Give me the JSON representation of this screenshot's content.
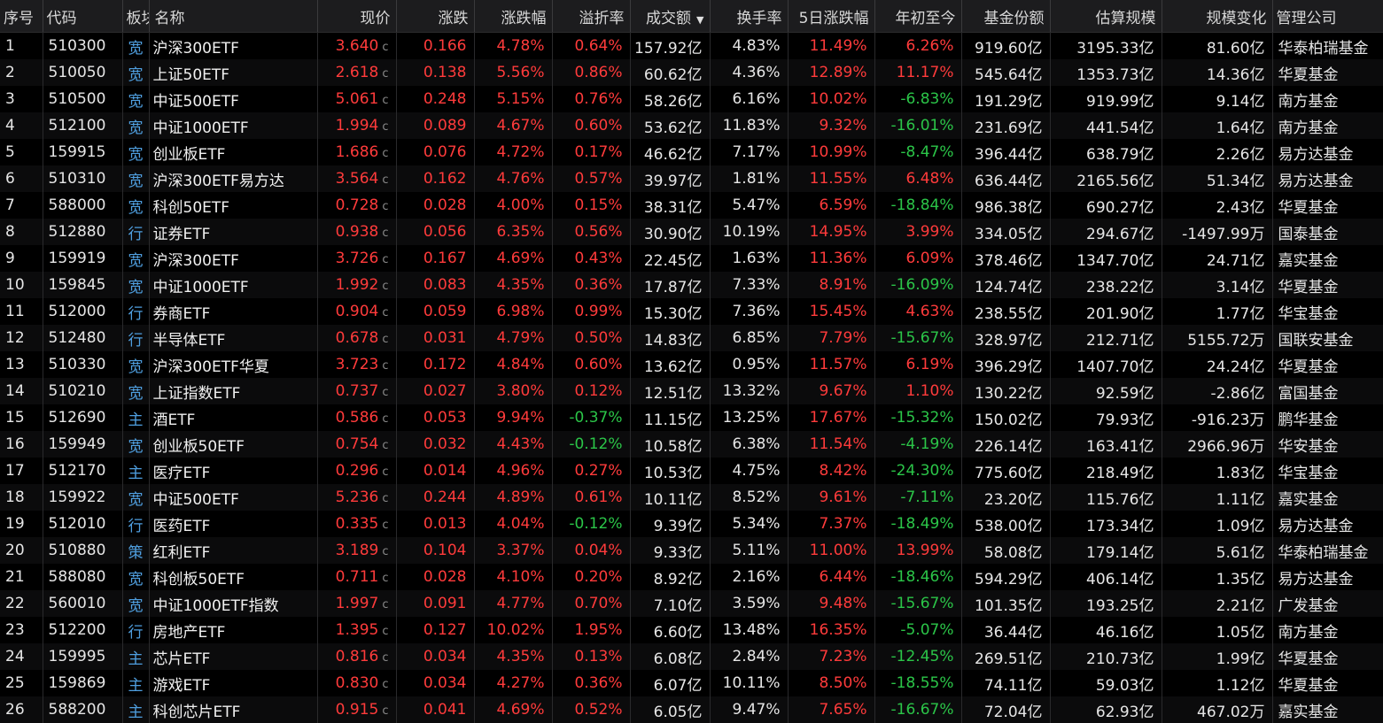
{
  "colors": {
    "up": "#ff3b3b",
    "down": "#2bc548",
    "sector": "#4f9fe0",
    "header_bg": "#1c1c1e"
  },
  "header": {
    "idx": "序号",
    "code": "代码",
    "sector": "板块",
    "name": "名称",
    "price": "现价",
    "change": "涨跌",
    "pct": "涨跌幅",
    "premium": "溢折率",
    "turnover_amt": "成交额",
    "turnover_rate": "换手率",
    "pct5d": "5日涨跌幅",
    "ytd": "年初至今",
    "shares": "基金份额",
    "scale": "估算规模",
    "scale_change": "规模变化",
    "manager": "管理公司"
  },
  "sort": {
    "column": "turnover_amt",
    "direction": "desc",
    "icon": "triangle-down"
  },
  "rows": [
    {
      "idx": "1",
      "code": "510300",
      "sector": "宽",
      "name": "沪深300ETF",
      "price": "3.640",
      "flag": "c",
      "change": "0.166",
      "pct": "4.78%",
      "premium": "0.64%",
      "premium_dir": "up",
      "turnover_amt": "157.92亿",
      "turnover_rate": "4.83%",
      "pct5d": "11.49%",
      "ytd": "6.26%",
      "ytd_dir": "up",
      "shares": "919.60亿",
      "scale": "3195.33亿",
      "scale_change": "81.60亿",
      "manager": "华泰柏瑞基金"
    },
    {
      "idx": "2",
      "code": "510050",
      "sector": "宽",
      "name": "上证50ETF",
      "price": "2.618",
      "flag": "c",
      "change": "0.138",
      "pct": "5.56%",
      "premium": "0.86%",
      "premium_dir": "up",
      "turnover_amt": "60.62亿",
      "turnover_rate": "4.36%",
      "pct5d": "12.89%",
      "ytd": "11.17%",
      "ytd_dir": "up",
      "shares": "545.64亿",
      "scale": "1353.73亿",
      "scale_change": "14.36亿",
      "manager": "华夏基金"
    },
    {
      "idx": "3",
      "code": "510500",
      "sector": "宽",
      "name": "中证500ETF",
      "price": "5.061",
      "flag": "c",
      "change": "0.248",
      "pct": "5.15%",
      "premium": "0.76%",
      "premium_dir": "up",
      "turnover_amt": "58.26亿",
      "turnover_rate": "6.16%",
      "pct5d": "10.02%",
      "ytd": "-6.83%",
      "ytd_dir": "down",
      "shares": "191.29亿",
      "scale": "919.99亿",
      "scale_change": "9.14亿",
      "manager": "南方基金"
    },
    {
      "idx": "4",
      "code": "512100",
      "sector": "宽",
      "name": "中证1000ETF",
      "price": "1.994",
      "flag": "c",
      "change": "0.089",
      "pct": "4.67%",
      "premium": "0.60%",
      "premium_dir": "up",
      "turnover_amt": "53.62亿",
      "turnover_rate": "11.83%",
      "pct5d": "9.32%",
      "ytd": "-16.01%",
      "ytd_dir": "down",
      "shares": "231.69亿",
      "scale": "441.54亿",
      "scale_change": "1.64亿",
      "manager": "南方基金"
    },
    {
      "idx": "5",
      "code": "159915",
      "sector": "宽",
      "name": "创业板ETF",
      "price": "1.686",
      "flag": "c",
      "change": "0.076",
      "pct": "4.72%",
      "premium": "0.17%",
      "premium_dir": "up",
      "turnover_amt": "46.62亿",
      "turnover_rate": "7.17%",
      "pct5d": "10.99%",
      "ytd": "-8.47%",
      "ytd_dir": "down",
      "shares": "396.44亿",
      "scale": "638.79亿",
      "scale_change": "2.26亿",
      "manager": "易方达基金"
    },
    {
      "idx": "6",
      "code": "510310",
      "sector": "宽",
      "name": "沪深300ETF易方达",
      "price": "3.564",
      "flag": "c",
      "change": "0.162",
      "pct": "4.76%",
      "premium": "0.57%",
      "premium_dir": "up",
      "turnover_amt": "39.97亿",
      "turnover_rate": "1.81%",
      "pct5d": "11.55%",
      "ytd": "6.48%",
      "ytd_dir": "up",
      "shares": "636.44亿",
      "scale": "2165.56亿",
      "scale_change": "51.34亿",
      "manager": "易方达基金"
    },
    {
      "idx": "7",
      "code": "588000",
      "sector": "宽",
      "name": "科创50ETF",
      "price": "0.728",
      "flag": "c",
      "change": "0.028",
      "pct": "4.00%",
      "premium": "0.15%",
      "premium_dir": "up",
      "turnover_amt": "38.31亿",
      "turnover_rate": "5.47%",
      "pct5d": "6.59%",
      "ytd": "-18.84%",
      "ytd_dir": "down",
      "shares": "986.38亿",
      "scale": "690.27亿",
      "scale_change": "2.43亿",
      "manager": "华夏基金"
    },
    {
      "idx": "8",
      "code": "512880",
      "sector": "行",
      "name": "证券ETF",
      "price": "0.938",
      "flag": "c",
      "change": "0.056",
      "pct": "6.35%",
      "premium": "0.56%",
      "premium_dir": "up",
      "turnover_amt": "30.90亿",
      "turnover_rate": "10.19%",
      "pct5d": "14.95%",
      "ytd": "3.99%",
      "ytd_dir": "up",
      "shares": "334.05亿",
      "scale": "294.67亿",
      "scale_change": "-1497.99万",
      "manager": "国泰基金"
    },
    {
      "idx": "9",
      "code": "159919",
      "sector": "宽",
      "name": "沪深300ETF",
      "price": "3.726",
      "flag": "c",
      "change": "0.167",
      "pct": "4.69%",
      "premium": "0.43%",
      "premium_dir": "up",
      "turnover_amt": "22.45亿",
      "turnover_rate": "1.63%",
      "pct5d": "11.36%",
      "ytd": "6.09%",
      "ytd_dir": "up",
      "shares": "378.46亿",
      "scale": "1347.70亿",
      "scale_change": "24.71亿",
      "manager": "嘉实基金"
    },
    {
      "idx": "10",
      "code": "159845",
      "sector": "宽",
      "name": "中证1000ETF",
      "price": "1.992",
      "flag": "c",
      "change": "0.083",
      "pct": "4.35%",
      "premium": "0.36%",
      "premium_dir": "up",
      "turnover_amt": "17.87亿",
      "turnover_rate": "7.33%",
      "pct5d": "8.91%",
      "ytd": "-16.09%",
      "ytd_dir": "down",
      "shares": "124.74亿",
      "scale": "238.22亿",
      "scale_change": "3.14亿",
      "manager": "华夏基金"
    },
    {
      "idx": "11",
      "code": "512000",
      "sector": "行",
      "name": "券商ETF",
      "price": "0.904",
      "flag": "c",
      "change": "0.059",
      "pct": "6.98%",
      "premium": "0.99%",
      "premium_dir": "up",
      "turnover_amt": "15.30亿",
      "turnover_rate": "7.36%",
      "pct5d": "15.45%",
      "ytd": "4.63%",
      "ytd_dir": "up",
      "shares": "238.55亿",
      "scale": "201.90亿",
      "scale_change": "1.77亿",
      "manager": "华宝基金"
    },
    {
      "idx": "12",
      "code": "512480",
      "sector": "行",
      "name": "半导体ETF",
      "price": "0.678",
      "flag": "c",
      "change": "0.031",
      "pct": "4.79%",
      "premium": "0.50%",
      "premium_dir": "up",
      "turnover_amt": "14.83亿",
      "turnover_rate": "6.85%",
      "pct5d": "7.79%",
      "ytd": "-15.67%",
      "ytd_dir": "down",
      "shares": "328.97亿",
      "scale": "212.71亿",
      "scale_change": "5155.72万",
      "manager": "国联安基金"
    },
    {
      "idx": "13",
      "code": "510330",
      "sector": "宽",
      "name": "沪深300ETF华夏",
      "price": "3.723",
      "flag": "c",
      "change": "0.172",
      "pct": "4.84%",
      "premium": "0.60%",
      "premium_dir": "up",
      "turnover_amt": "13.62亿",
      "turnover_rate": "0.95%",
      "pct5d": "11.57%",
      "ytd": "6.19%",
      "ytd_dir": "up",
      "shares": "396.29亿",
      "scale": "1407.70亿",
      "scale_change": "24.24亿",
      "manager": "华夏基金"
    },
    {
      "idx": "14",
      "code": "510210",
      "sector": "宽",
      "name": "上证指数ETF",
      "price": "0.737",
      "flag": "c",
      "change": "0.027",
      "pct": "3.80%",
      "premium": "0.12%",
      "premium_dir": "up",
      "turnover_amt": "12.51亿",
      "turnover_rate": "13.32%",
      "pct5d": "9.67%",
      "ytd": "1.10%",
      "ytd_dir": "up",
      "shares": "130.22亿",
      "scale": "92.59亿",
      "scale_change": "-2.86亿",
      "manager": "富国基金"
    },
    {
      "idx": "15",
      "code": "512690",
      "sector": "主",
      "name": "酒ETF",
      "price": "0.586",
      "flag": "c",
      "change": "0.053",
      "pct": "9.94%",
      "premium": "-0.37%",
      "premium_dir": "down",
      "turnover_amt": "11.15亿",
      "turnover_rate": "13.25%",
      "pct5d": "17.67%",
      "ytd": "-15.32%",
      "ytd_dir": "down",
      "shares": "150.02亿",
      "scale": "79.93亿",
      "scale_change": "-916.23万",
      "manager": "鹏华基金"
    },
    {
      "idx": "16",
      "code": "159949",
      "sector": "宽",
      "name": "创业板50ETF",
      "price": "0.754",
      "flag": "c",
      "change": "0.032",
      "pct": "4.43%",
      "premium": "-0.12%",
      "premium_dir": "down",
      "turnover_amt": "10.58亿",
      "turnover_rate": "6.38%",
      "pct5d": "11.54%",
      "ytd": "-4.19%",
      "ytd_dir": "down",
      "shares": "226.14亿",
      "scale": "163.41亿",
      "scale_change": "2966.96万",
      "manager": "华安基金"
    },
    {
      "idx": "17",
      "code": "512170",
      "sector": "主",
      "name": "医疗ETF",
      "price": "0.296",
      "flag": "c",
      "change": "0.014",
      "pct": "4.96%",
      "premium": "0.27%",
      "premium_dir": "up",
      "turnover_amt": "10.53亿",
      "turnover_rate": "4.75%",
      "pct5d": "8.42%",
      "ytd": "-24.30%",
      "ytd_dir": "down",
      "shares": "775.60亿",
      "scale": "218.49亿",
      "scale_change": "1.83亿",
      "manager": "华宝基金"
    },
    {
      "idx": "18",
      "code": "159922",
      "sector": "宽",
      "name": "中证500ETF",
      "price": "5.236",
      "flag": "c",
      "change": "0.244",
      "pct": "4.89%",
      "premium": "0.61%",
      "premium_dir": "up",
      "turnover_amt": "10.11亿",
      "turnover_rate": "8.52%",
      "pct5d": "9.61%",
      "ytd": "-7.11%",
      "ytd_dir": "down",
      "shares": "23.20亿",
      "scale": "115.76亿",
      "scale_change": "1.11亿",
      "manager": "嘉实基金"
    },
    {
      "idx": "19",
      "code": "512010",
      "sector": "行",
      "name": "医药ETF",
      "price": "0.335",
      "flag": "c",
      "change": "0.013",
      "pct": "4.04%",
      "premium": "-0.12%",
      "premium_dir": "down",
      "turnover_amt": "9.39亿",
      "turnover_rate": "5.34%",
      "pct5d": "7.37%",
      "ytd": "-18.49%",
      "ytd_dir": "down",
      "shares": "538.00亿",
      "scale": "173.34亿",
      "scale_change": "1.09亿",
      "manager": "易方达基金"
    },
    {
      "idx": "20",
      "code": "510880",
      "sector": "策",
      "name": "红利ETF",
      "price": "3.189",
      "flag": "c",
      "change": "0.104",
      "pct": "3.37%",
      "premium": "0.04%",
      "premium_dir": "up",
      "turnover_amt": "9.33亿",
      "turnover_rate": "5.11%",
      "pct5d": "11.00%",
      "ytd": "13.99%",
      "ytd_dir": "up",
      "shares": "58.08亿",
      "scale": "179.14亿",
      "scale_change": "5.61亿",
      "manager": "华泰柏瑞基金"
    },
    {
      "idx": "21",
      "code": "588080",
      "sector": "宽",
      "name": "科创板50ETF",
      "price": "0.711",
      "flag": "c",
      "change": "0.028",
      "pct": "4.10%",
      "premium": "0.20%",
      "premium_dir": "up",
      "turnover_amt": "8.92亿",
      "turnover_rate": "2.16%",
      "pct5d": "6.44%",
      "ytd": "-18.46%",
      "ytd_dir": "down",
      "shares": "594.29亿",
      "scale": "406.14亿",
      "scale_change": "1.35亿",
      "manager": "易方达基金"
    },
    {
      "idx": "22",
      "code": "560010",
      "sector": "宽",
      "name": "中证1000ETF指数",
      "price": "1.997",
      "flag": "c",
      "change": "0.091",
      "pct": "4.77%",
      "premium": "0.70%",
      "premium_dir": "up",
      "turnover_amt": "7.10亿",
      "turnover_rate": "3.59%",
      "pct5d": "9.48%",
      "ytd": "-15.67%",
      "ytd_dir": "down",
      "shares": "101.35亿",
      "scale": "193.25亿",
      "scale_change": "2.21亿",
      "manager": "广发基金"
    },
    {
      "idx": "23",
      "code": "512200",
      "sector": "行",
      "name": "房地产ETF",
      "price": "1.395",
      "flag": "c",
      "change": "0.127",
      "pct": "10.02%",
      "premium": "1.95%",
      "premium_dir": "up",
      "turnover_amt": "6.60亿",
      "turnover_rate": "13.48%",
      "pct5d": "16.35%",
      "ytd": "-5.07%",
      "ytd_dir": "down",
      "shares": "36.44亿",
      "scale": "46.16亿",
      "scale_change": "1.05亿",
      "manager": "南方基金"
    },
    {
      "idx": "24",
      "code": "159995",
      "sector": "主",
      "name": "芯片ETF",
      "price": "0.816",
      "flag": "c",
      "change": "0.034",
      "pct": "4.35%",
      "premium": "0.13%",
      "premium_dir": "up",
      "turnover_amt": "6.08亿",
      "turnover_rate": "2.84%",
      "pct5d": "7.23%",
      "ytd": "-12.45%",
      "ytd_dir": "down",
      "shares": "269.51亿",
      "scale": "210.73亿",
      "scale_change": "1.99亿",
      "manager": "华夏基金"
    },
    {
      "idx": "25",
      "code": "159869",
      "sector": "主",
      "name": "游戏ETF",
      "price": "0.830",
      "flag": "c",
      "change": "0.034",
      "pct": "4.27%",
      "premium": "0.36%",
      "premium_dir": "up",
      "turnover_amt": "6.07亿",
      "turnover_rate": "10.11%",
      "pct5d": "8.50%",
      "ytd": "-18.55%",
      "ytd_dir": "down",
      "shares": "74.11亿",
      "scale": "59.03亿",
      "scale_change": "1.12亿",
      "manager": "华夏基金"
    },
    {
      "idx": "26",
      "code": "588200",
      "sector": "主",
      "name": "科创芯片ETF",
      "price": "0.915",
      "flag": "c",
      "change": "0.041",
      "pct": "4.69%",
      "premium": "0.52%",
      "premium_dir": "up",
      "turnover_amt": "6.05亿",
      "turnover_rate": "9.47%",
      "pct5d": "7.65%",
      "ytd": "-16.67%",
      "ytd_dir": "down",
      "shares": "72.04亿",
      "scale": "62.93亿",
      "scale_change": "467.02万",
      "manager": "嘉实基金"
    }
  ]
}
